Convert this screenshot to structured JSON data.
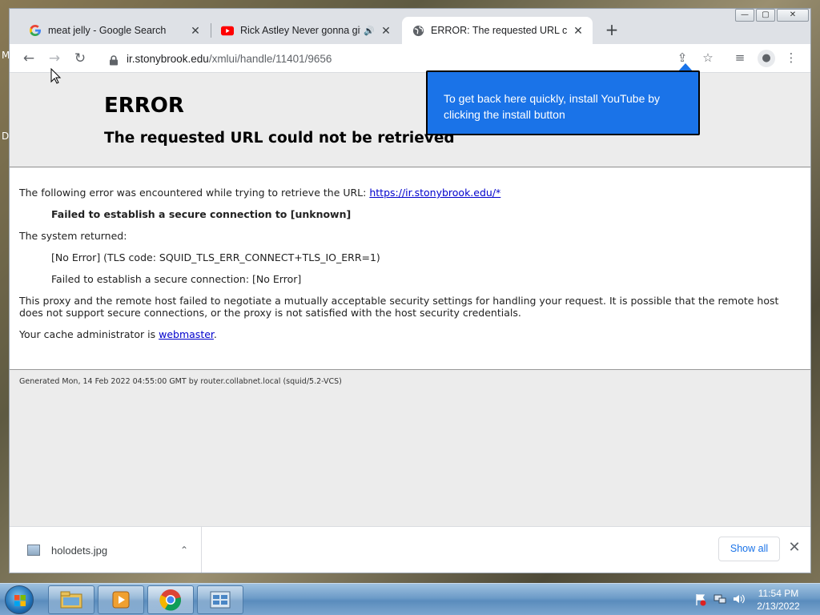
{
  "desktop": {
    "left_edge_letters": [
      "M",
      "D"
    ]
  },
  "browser": {
    "tabs": [
      {
        "title": "meat jelly - Google Search",
        "favicon": "google-g-icon"
      },
      {
        "title": "Rick Astley Never gonna give you up",
        "favicon": "youtube-icon",
        "audio": "🔊"
      },
      {
        "title": "ERROR: The requested URL could not be retrieved",
        "favicon": "globe-icon",
        "active": true
      }
    ],
    "new_tab": "+",
    "window_controls": {
      "minimize": "—",
      "maximize": "▢",
      "close": "✕"
    },
    "toolbar": {
      "back": "←",
      "forward": "→",
      "reload": "↻",
      "url_host": "ir.stonybrook.edu",
      "url_path": "/xmlui/handle/11401/9656",
      "share": "⇪",
      "bookmark": "☆",
      "reading_list": "≡",
      "profile": "●",
      "menu": "⋮"
    }
  },
  "page": {
    "heading": "ERROR",
    "subheading": "The requested URL could not be retrieved",
    "intro_text": "The following error was encountered while trying to retrieve the URL: ",
    "url_link": "https://ir.stonybrook.edu/*",
    "failed_line": "Failed to establish a secure connection to [unknown]",
    "system_returned_label": "The system returned:",
    "no_error_line": "[No Error] (TLS code: SQUID_TLS_ERR_CONNECT+TLS_IO_ERR=1)",
    "secure_conn_line": "Failed to establish a secure connection: [No Error]",
    "explanation": "This proxy and the remote host failed to negotiate a mutually acceptable security settings for handling your request. It is possible that the remote host does not support secure connections, or the proxy is not satisfied with the host security credentials.",
    "admin_prefix": "Your cache administrator is ",
    "admin_link": "webmaster",
    "admin_suffix": ".",
    "generated": "Generated Mon, 14 Feb 2022 04:55:00 GMT by router.collabnet.local (squid/5.2-VCS)"
  },
  "popup": {
    "text": "To get back here quickly, install YouTube by clicking the install button"
  },
  "downloads": {
    "file_name": "holodets.jpg",
    "expand": "⌃",
    "show_all": "Show all",
    "close": "✕"
  },
  "taskbar": {
    "time": "11:54 PM",
    "date": "2/13/2022"
  },
  "colors": {
    "accent": "#1a73e8",
    "link": "#0000cc"
  }
}
